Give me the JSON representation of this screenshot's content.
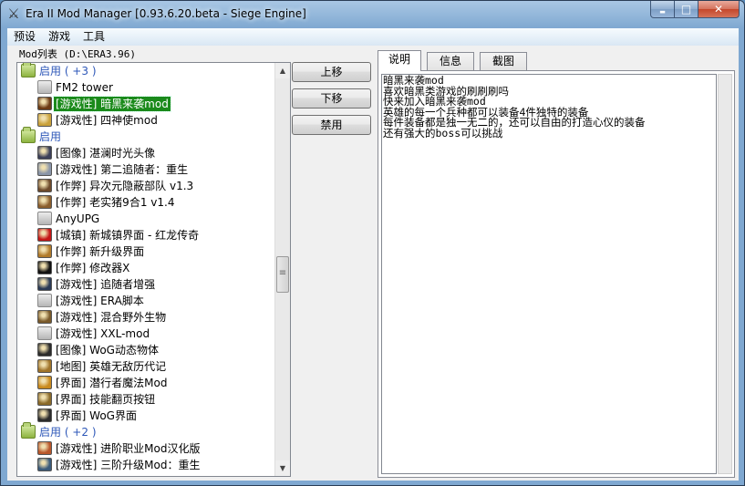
{
  "window": {
    "title": "Era II Mod Manager [0.93.6.20.beta - Siege Engine]",
    "app_icon": "crossed-swords-icon"
  },
  "window_buttons": {
    "minimize": "▬",
    "maximize": "□",
    "close": "✕"
  },
  "menu": [
    "预设",
    "游戏",
    "工具"
  ],
  "mod_list_label": "Mod列表 (D:\\ERA3.96)",
  "tree": [
    {
      "type": "group",
      "label": "启用 ( +3 )",
      "icon": "folder-icon"
    },
    {
      "type": "item",
      "label": "FM2 tower",
      "icon": "plain-folder-icon"
    },
    {
      "type": "item",
      "label": "[游戏性] 暗黑来袭mod",
      "icon": "monster-icon",
      "color": "#6b3a14",
      "selected": true
    },
    {
      "type": "item",
      "label": "[游戏性] 四神使mod",
      "icon": "emblem-icon",
      "color": "#c9a13b"
    },
    {
      "type": "group",
      "label": "启用",
      "icon": "folder-icon"
    },
    {
      "type": "item",
      "label": "[图像] 湛澜时光头像",
      "icon": "portrait-icon",
      "color": "#3b3f58"
    },
    {
      "type": "item",
      "label": "[游戏性] 第二追随者：重生",
      "icon": "knight-icon",
      "color": "#8a95a8"
    },
    {
      "type": "item",
      "label": "[作弊] 异次元隐蔽部队 v1.3",
      "icon": "army-icon",
      "color": "#6d4a2b"
    },
    {
      "type": "item",
      "label": "[作弊] 老实猪9合1 v1.4",
      "icon": "hero-icon",
      "color": "#8b5e2c"
    },
    {
      "type": "item",
      "label": "AnyUPG",
      "icon": "plain-folder-icon"
    },
    {
      "type": "item",
      "label": "[城镇] 新城镇界面 - 红龙传奇",
      "icon": "dragon-icon",
      "color": "#c41616"
    },
    {
      "type": "item",
      "label": "[作弊] 新升级界面",
      "icon": "upgrade-icon",
      "color": "#b07a2a"
    },
    {
      "type": "item",
      "label": "[作弊] 修改器X",
      "icon": "skull-icon",
      "color": "#111111"
    },
    {
      "type": "item",
      "label": "[游戏性] 追随者增强",
      "icon": "follower-icon",
      "color": "#2a3a55"
    },
    {
      "type": "item",
      "label": "[游戏性] ERA脚本",
      "icon": "plain-folder-icon"
    },
    {
      "type": "item",
      "label": "[游戏性] 混合野外生物",
      "icon": "creature-icon",
      "color": "#7a5a2a"
    },
    {
      "type": "item",
      "label": "[游戏性] XXL-mod",
      "icon": "plain-folder-icon"
    },
    {
      "type": "item",
      "label": "[图像] WoG动态物体",
      "icon": "object-icon",
      "color": "#2b2b2b"
    },
    {
      "type": "item",
      "label": "[地图] 英雄无敌历代记",
      "icon": "chronicles-icon",
      "color": "#a0742a"
    },
    {
      "type": "item",
      "label": "[界面] 潜行者魔法Mod",
      "icon": "spell-icon",
      "color": "#c98a1e"
    },
    {
      "type": "item",
      "label": "[界面] 技能翻页按钮",
      "icon": "skill-icon",
      "color": "#8a6a2a"
    },
    {
      "type": "item",
      "label": "[界面] WoG界面",
      "icon": "wog-icon",
      "color": "#2b2b2b"
    },
    {
      "type": "group",
      "label": "启用 ( +2 )",
      "icon": "folder-icon"
    },
    {
      "type": "item",
      "label": "[游戏性] 进阶职业Mod汉化版",
      "icon": "class-icon",
      "color": "#b8562a"
    },
    {
      "type": "item",
      "label": "[游戏性] 三阶升级Mod：重生",
      "icon": "tier3-icon",
      "color": "#3a5a7a"
    }
  ],
  "buttons": {
    "up": "上移",
    "down": "下移",
    "disable": "禁用"
  },
  "tabs": [
    "说明",
    "信息",
    "截图"
  ],
  "active_tab": 0,
  "description_lines": [
    "暗黑来袭mod",
    "喜欢暗黑类游戏的刷刷刷吗",
    "快来加入暗黑来袭mod",
    "英雄的每一个兵种都可以装备4件独特的装备",
    "每件装备都是独一无二的，还可以自由的打造心仪的装备",
    "还有强大的boss可以挑战"
  ]
}
